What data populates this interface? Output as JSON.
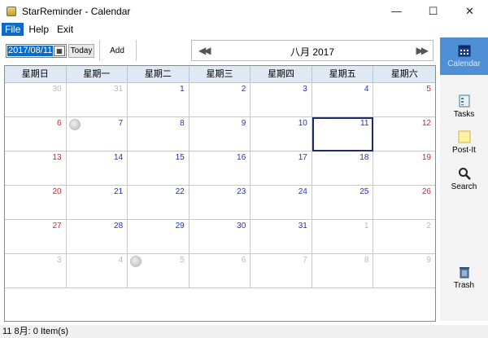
{
  "window": {
    "title": "StarReminder - Calendar"
  },
  "window_controls": {
    "minimize": "—",
    "maximize": "☐",
    "close": "✕"
  },
  "menu": [
    "File",
    "Help",
    "Exit"
  ],
  "toolbar": {
    "date_value": "2017/08/11",
    "today_label": "Today",
    "add_label": "Add",
    "month_label": "八月 2017"
  },
  "sidebar": [
    {
      "label": "Calendar",
      "icon": "calendar-icon",
      "active": true
    },
    {
      "label": "Tasks",
      "icon": "tasks-icon",
      "active": false
    },
    {
      "label": "Post-It",
      "icon": "post-it-icon",
      "active": false
    },
    {
      "label": "Search",
      "icon": "search-icon",
      "active": false
    },
    {
      "label": "Trash",
      "icon": "trash-icon",
      "active": false
    }
  ],
  "calendar": {
    "headers": [
      "星期日",
      "星期一",
      "星期二",
      "星期三",
      "星期四",
      "星期五",
      "星期六"
    ],
    "days": [
      {
        "n": "30",
        "other": true
      },
      {
        "n": "31",
        "other": true
      },
      {
        "n": "1"
      },
      {
        "n": "2"
      },
      {
        "n": "3"
      },
      {
        "n": "4"
      },
      {
        "n": "5"
      },
      {
        "n": "6"
      },
      {
        "n": "7",
        "moon": true
      },
      {
        "n": "8"
      },
      {
        "n": "9"
      },
      {
        "n": "10"
      },
      {
        "n": "11",
        "selected": true
      },
      {
        "n": "12"
      },
      {
        "n": "13"
      },
      {
        "n": "14"
      },
      {
        "n": "15"
      },
      {
        "n": "16"
      },
      {
        "n": "17"
      },
      {
        "n": "18"
      },
      {
        "n": "19"
      },
      {
        "n": "20"
      },
      {
        "n": "21"
      },
      {
        "n": "22"
      },
      {
        "n": "23"
      },
      {
        "n": "24"
      },
      {
        "n": "25"
      },
      {
        "n": "26"
      },
      {
        "n": "27"
      },
      {
        "n": "28"
      },
      {
        "n": "29"
      },
      {
        "n": "30"
      },
      {
        "n": "31"
      },
      {
        "n": "1",
        "other": true
      },
      {
        "n": "2",
        "other": true
      },
      {
        "n": "3",
        "other": true
      },
      {
        "n": "4",
        "other": true
      },
      {
        "n": "5",
        "other": true,
        "moon": true
      },
      {
        "n": "6",
        "other": true
      },
      {
        "n": "7",
        "other": true
      },
      {
        "n": "8",
        "other": true
      },
      {
        "n": "9",
        "other": true
      }
    ]
  },
  "status": {
    "text": "11 8月: 0 Item(s)"
  },
  "colors": {
    "accent": "#0a6cc8",
    "sidebar_active": "#4e8fd6",
    "header_bg": "#dfe9f6",
    "weekday_num": "#1d2fd6",
    "weekend_num": "#e01e1e",
    "other_month_num": "#b9b9b9",
    "selected_border": "#1f2a6e"
  }
}
